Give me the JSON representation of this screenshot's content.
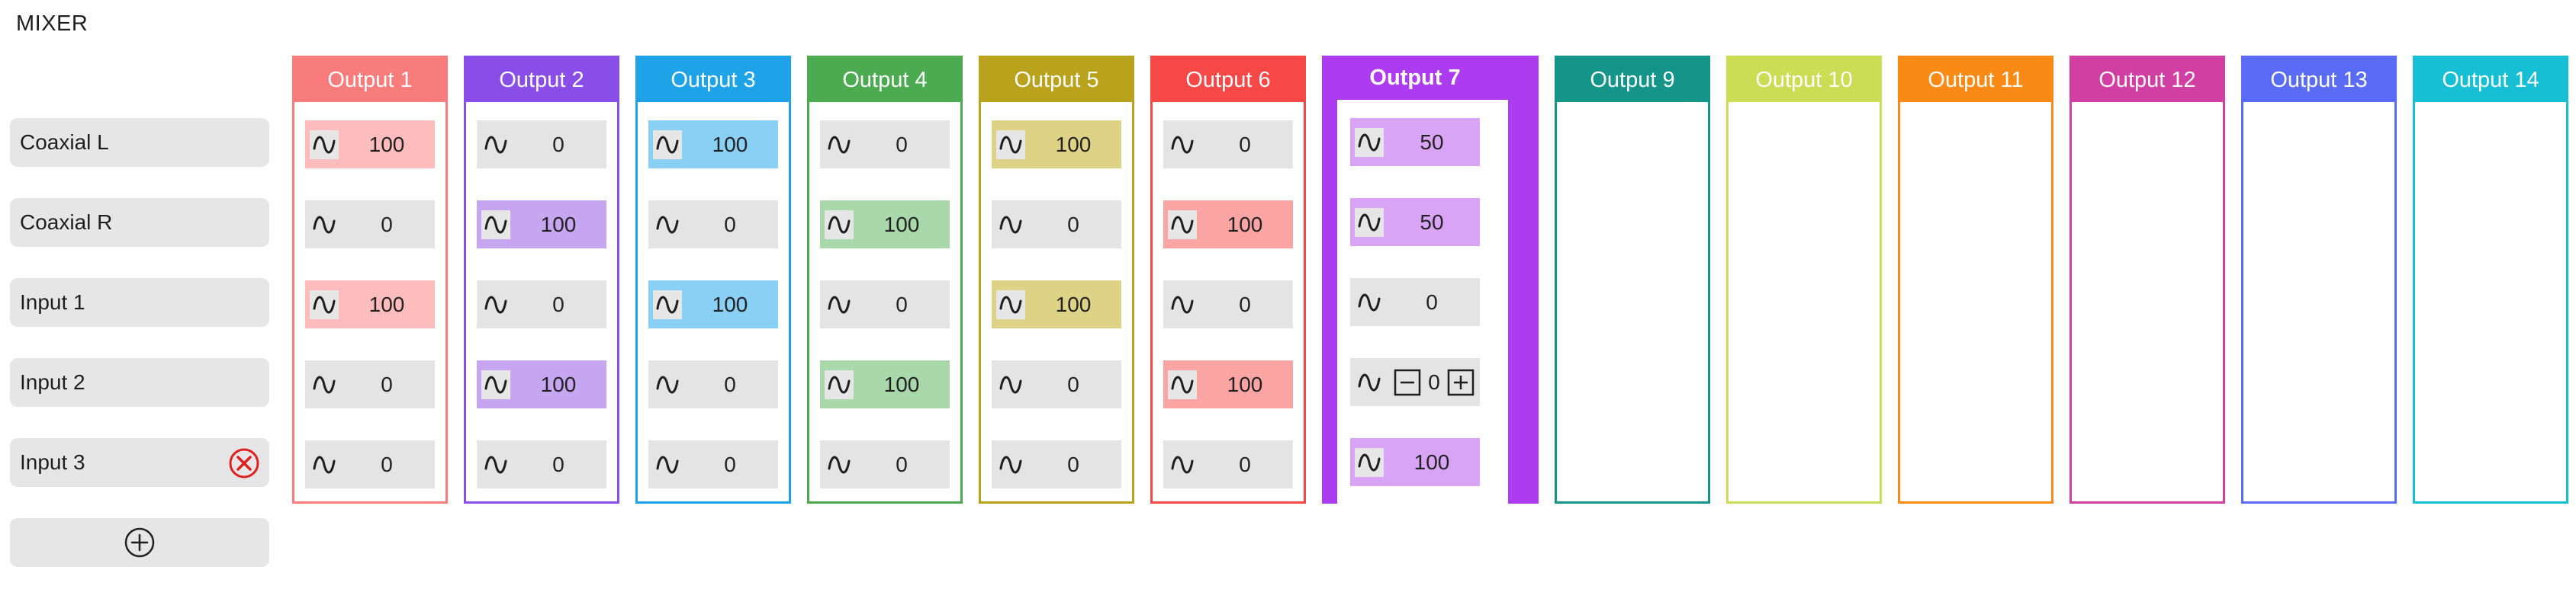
{
  "app": {
    "title": "MIXER"
  },
  "inputs": [
    {
      "label": "Coaxial L",
      "removable": false
    },
    {
      "label": "Coaxial R",
      "removable": false
    },
    {
      "label": "Input 1",
      "removable": false
    },
    {
      "label": "Input 2",
      "removable": false
    },
    {
      "label": "Input 3",
      "removable": true
    }
  ],
  "add_input_icon": "plus-circle-icon",
  "remove_input_icon": "close-circle-icon",
  "outputs": [
    {
      "label": "Output 1",
      "color": "#f87c7c",
      "fill": "#ffbcbc",
      "selected": false,
      "values": [
        "100",
        "0",
        "100",
        "0",
        "0"
      ],
      "active": [
        true,
        false,
        true,
        false,
        false
      ]
    },
    {
      "label": "Output 2",
      "color": "#8a4ee8",
      "fill": "#c7a6f1",
      "selected": false,
      "values": [
        "0",
        "100",
        "0",
        "100",
        "0"
      ],
      "active": [
        false,
        true,
        false,
        true,
        false
      ]
    },
    {
      "label": "Output 3",
      "color": "#1ea3e8",
      "fill": "#8ad0f5",
      "selected": false,
      "values": [
        "100",
        "0",
        "100",
        "0",
        "0"
      ],
      "active": [
        true,
        false,
        true,
        false,
        false
      ]
    },
    {
      "label": "Output 4",
      "color": "#4cab51",
      "fill": "#a9d8ab",
      "selected": false,
      "values": [
        "0",
        "100",
        "0",
        "100",
        "0"
      ],
      "active": [
        false,
        true,
        false,
        true,
        false
      ]
    },
    {
      "label": "Output 5",
      "color": "#b9a21c",
      "fill": "#ddd285",
      "selected": false,
      "values": [
        "100",
        "0",
        "100",
        "0",
        "0"
      ],
      "active": [
        true,
        false,
        true,
        false,
        false
      ]
    },
    {
      "label": "Output 6",
      "color": "#f74848",
      "fill": "#fba4a4",
      "selected": false,
      "values": [
        "0",
        "100",
        "0",
        "100",
        "0"
      ],
      "active": [
        false,
        true,
        false,
        true,
        false
      ]
    },
    {
      "label": "Output 7",
      "color": "#ad3bef",
      "fill": "#d9a4f5",
      "selected": true,
      "values": [
        "50",
        "50",
        "0",
        "0",
        "100"
      ],
      "active": [
        true,
        true,
        false,
        false,
        true
      ],
      "stepper_row": 3
    },
    {
      "label": "Output 9",
      "color": "#15958a",
      "selected": false
    },
    {
      "label": "Output 10",
      "color": "#cbdc55",
      "selected": false
    },
    {
      "label": "Output 11",
      "color": "#f88a15",
      "selected": false
    },
    {
      "label": "Output 12",
      "color": "#d23fa2",
      "selected": false
    },
    {
      "label": "Output 13",
      "color": "#5a6cf5",
      "selected": false
    },
    {
      "label": "Output 14",
      "color": "#17bfd5",
      "selected": false
    }
  ]
}
